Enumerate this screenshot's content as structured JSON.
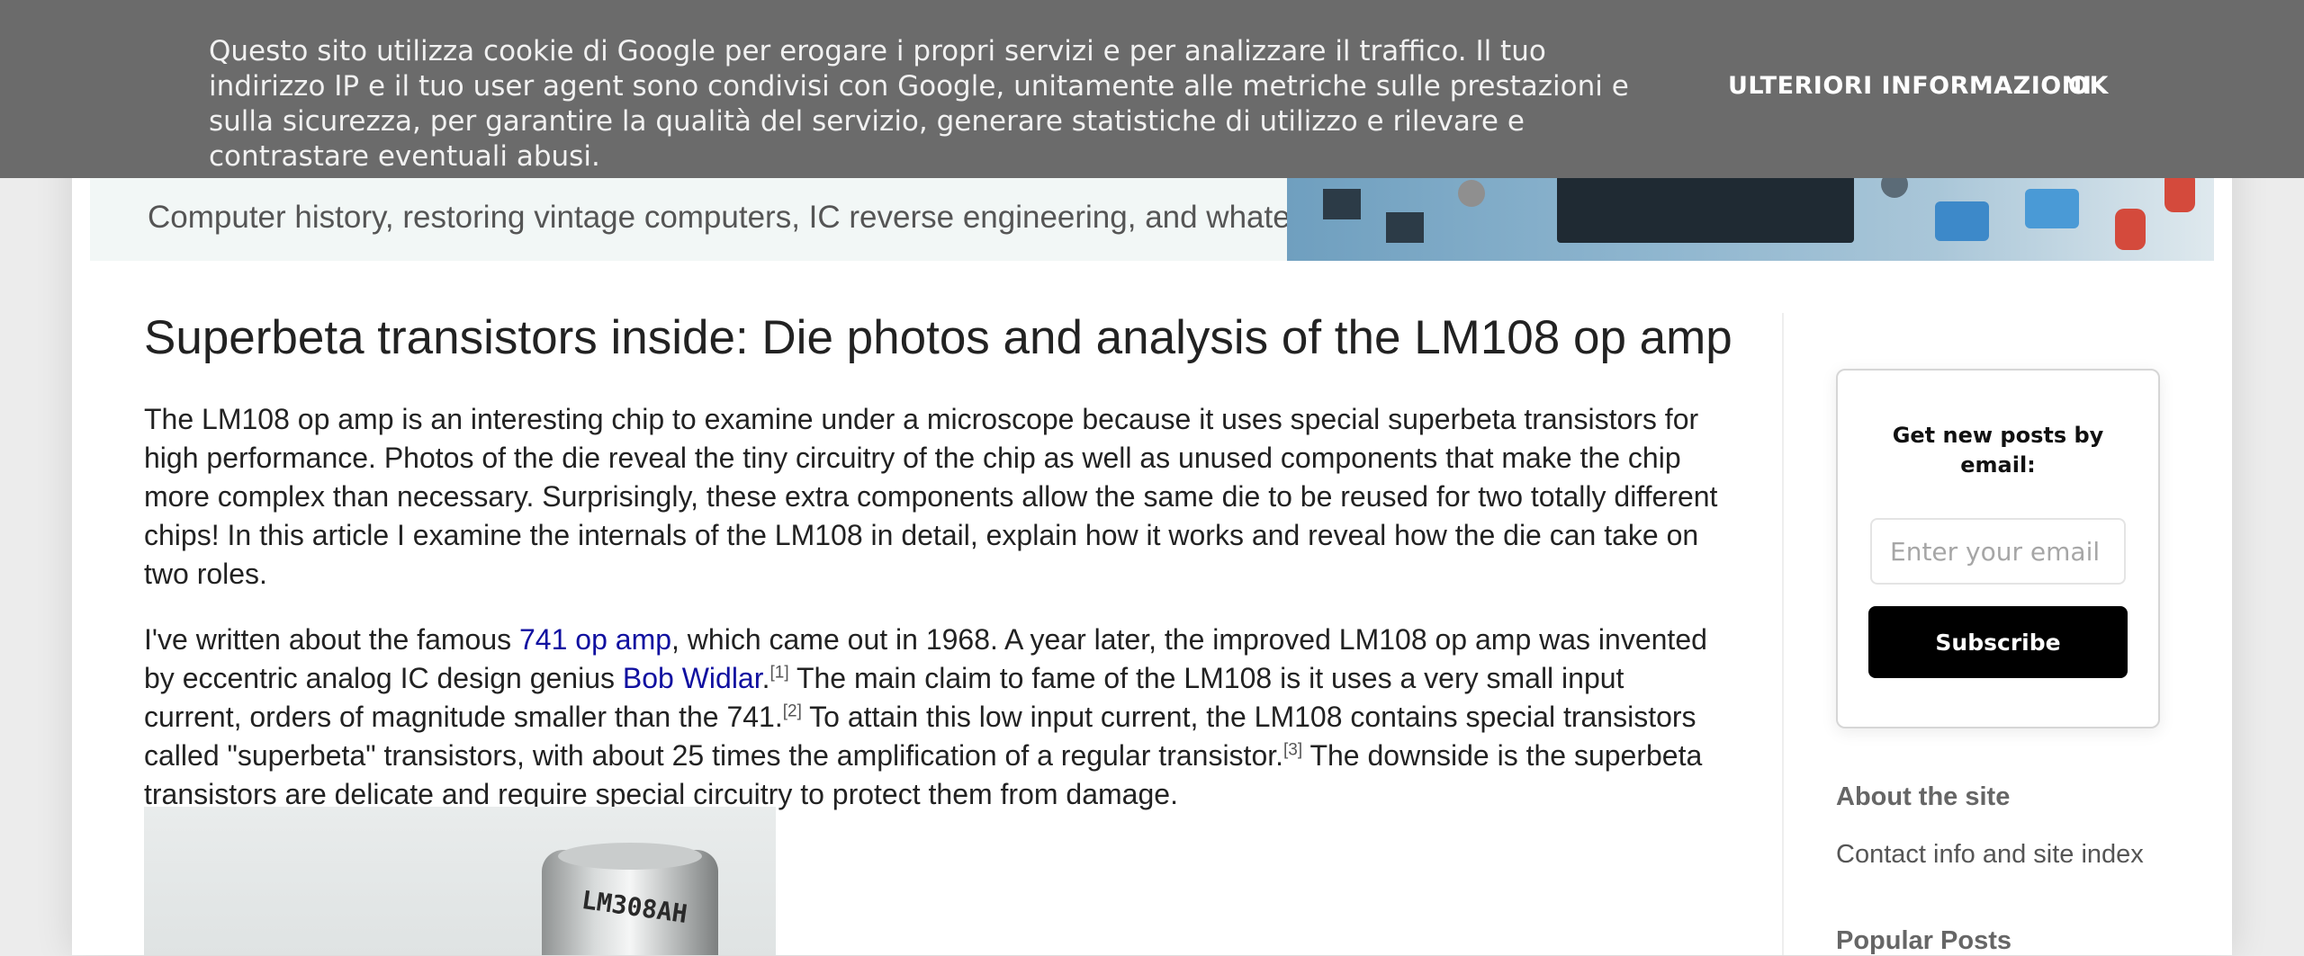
{
  "cookie_bar": {
    "text": "Questo sito utilizza cookie di Google per erogare i propri servizi e per analizzare il traffico. Il tuo indirizzo IP e il tuo user agent sono condivisi con Google, unitamente alle metriche sulle prestazioni e sulla sicurezza, per garantire la qualità del servizio, generare statistiche di utilizzo e rilevare e contrastare eventuali abusi.",
    "more_info_label": "ULTERIORI INFORMAZIONI",
    "ok_label": "OK"
  },
  "header": {
    "tagline": "Computer history, restoring vintage computers, IC reverse engineering, and whatever"
  },
  "post": {
    "title": "Superbeta transistors inside: Die photos and analysis of the LM108 op amp",
    "p1": "The LM108 op amp is an interesting chip to examine under a microscope because it uses special superbeta transistors for high performance. Photos of the die reveal the tiny circuitry of the chip as well as unused components that make the chip more complex than necessary. Surprisingly, these extra components allow the same die to be reused for two totally different chips! In this article I examine the internals of the LM108 in detail, explain how it works and reveal how the die can take on two roles.",
    "p2": {
      "t1": "I've written about the famous ",
      "link1": "741 op amp",
      "t2": ", which came out in 1968. A year later, the improved LM108 op amp was invented by eccentric analog IC design genius ",
      "link2": "Bob Widlar",
      "t3": ".",
      "ref1": "[1]",
      "t4": " The main claim to fame of the LM108 is it uses a very small input current, orders of magnitude smaller than the 741.",
      "ref2": "[2]",
      "t5": " To attain this low input current, the LM108 contains special transistors called \"superbeta\" transistors, with about 25 times the amplification of a regular transistor.",
      "ref3": "[3]",
      "t6": " The downside is the superbeta transistors are delicate and require special circuitry to protect them from damage."
    },
    "photo_label": "LM308AH"
  },
  "sidebar": {
    "subscribe_heading": "Get new posts by email:",
    "email_placeholder": "Enter your email",
    "subscribe_label": "Subscribe",
    "about_heading": "About the site",
    "about_link": "Contact info and site index",
    "popular_heading": "Popular Posts"
  }
}
